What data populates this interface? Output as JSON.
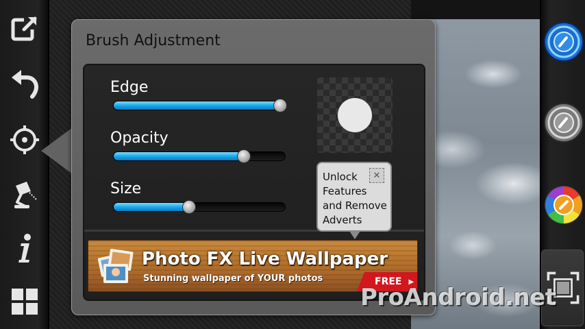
{
  "popup": {
    "title": "Brush Adjustment",
    "sliders": [
      {
        "label": "Edge",
        "value": 0.97
      },
      {
        "label": "Opacity",
        "value": 0.76
      },
      {
        "label": "Size",
        "value": 0.44
      }
    ]
  },
  "tooltip": {
    "text": "Unlock Features and Remove Adverts",
    "close_symbol": "✕"
  },
  "ad": {
    "title": "Photo FX Live Wallpaper",
    "subtitle": "Stunning wallpaper of YOUR photos",
    "cta": "FREE",
    "cta_arrow": "▶"
  },
  "watermark": "ProAndroid.net",
  "left_toolbar": [
    "share-icon",
    "undo-icon",
    "brush-target-icon",
    "lamp-icon",
    "info-icon",
    "grid-icon"
  ],
  "right_toolbar": [
    "brush-blue-icon",
    "brush-gray-icon",
    "color-wheel-icon",
    "crop-icon"
  ],
  "colors": {
    "accent": "#1aa8ec",
    "ad_red": "#d0181e"
  }
}
